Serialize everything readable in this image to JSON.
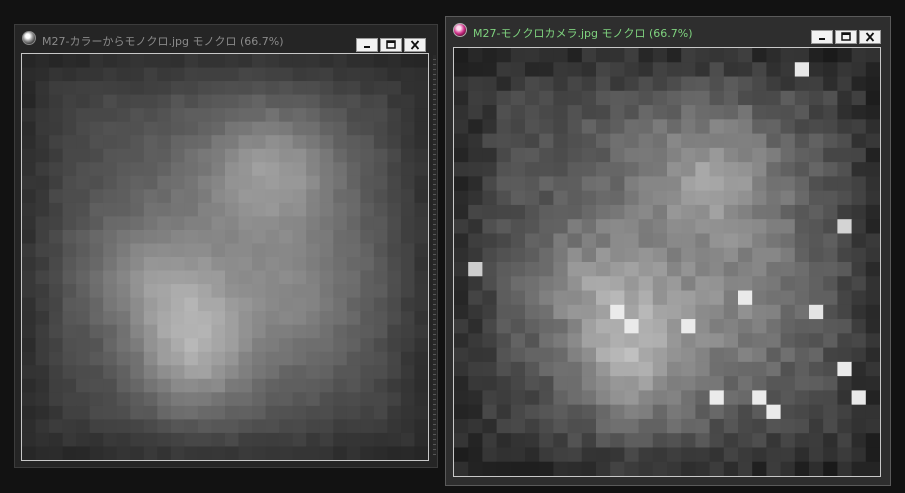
{
  "windows": [
    {
      "id": "left",
      "title": "M27-カラーからモノクロ.jpg モノクロ (66.7%)",
      "icon": "app-icon-grey",
      "title_color": "#8a8a8a",
      "controls": [
        "minimize",
        "maximize",
        "close"
      ]
    },
    {
      "id": "right",
      "title": "M27-モノクロカメラ.jpg モノクロ (66.7%)",
      "icon": "app-icon-magenta",
      "title_color": "#7fd37f",
      "active": true,
      "controls": [
        "minimize",
        "maximize",
        "close"
      ]
    }
  ],
  "image_style": {
    "left": "smooth grayscale nebula, soft edges",
    "right": "noisy grayscale nebula with bright hot pixels"
  }
}
